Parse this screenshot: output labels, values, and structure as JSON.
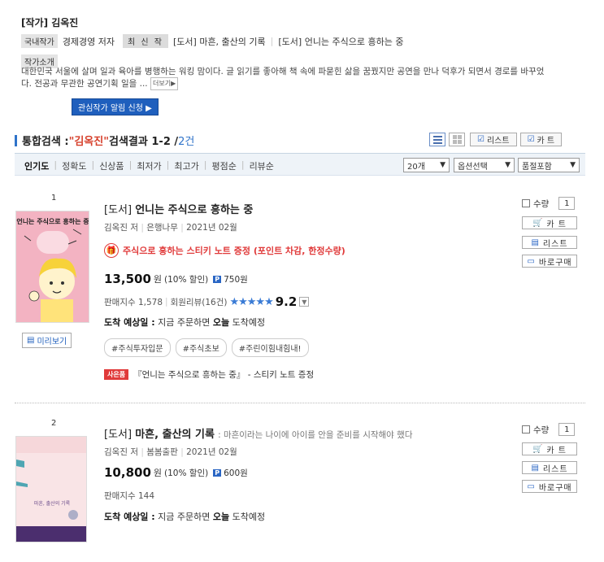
{
  "author": {
    "title": "[작가] 김옥진",
    "nationality_tag": "국내작가",
    "field": "경제경영 저자",
    "latest_tag": "최 신 작",
    "latest_books": [
      "[도서] 마흔, 출산의 기록",
      "[도서] 언니는 주식으로 흥하는 중"
    ],
    "intro_label": "작가소개",
    "intro_text": "대한민국 서울에 살며 일과 육아를 병행하는 워킹 맘이다. 글 읽기를 좋아해 책 속에 파묻힌 삶을 꿈꿨지만 공연을 만나 덕후가 되면서 경로를 바꾸었다. 전공과 무관한 공연기획 일을 ...",
    "more_label": "더보기",
    "follow_button": "관심작가 알림 신청 ▶"
  },
  "results": {
    "heading_prefix": "통합검색 : ",
    "keyword": "\"김옥진\"",
    "heading_suffix": " 검색결과 1-2 / ",
    "total": "2건",
    "list_button": "리스트",
    "cart_button": "카 트"
  },
  "sort": {
    "options": [
      "인기도",
      "정확도",
      "신상품",
      "최저가",
      "최고가",
      "평점순",
      "리뷰순"
    ],
    "per_page": "20개",
    "option_select": "옵션선택",
    "stock_select": "품절포함"
  },
  "items": [
    {
      "rank": "1",
      "category": "[도서]",
      "title": "언니는 주식으로 흥하는 중",
      "subtitle": "",
      "author": "김옥진 저",
      "publisher": "은행나무",
      "date": "2021년 02월",
      "event_icon": "gift-icon",
      "event_text": "주식으로 흥하는 스티키 노트 증정 (포인트 차감, 한정수량)",
      "price": "13,500",
      "won": "원",
      "discount": "(10% 할인)",
      "points": "750원",
      "sales": "판매지수 1,578",
      "reviews": "회원리뷰(16건)",
      "stars": "★★★★★",
      "score": "9.2",
      "arrival_label": "도착 예상일 :",
      "arrival_pre": "지금 주문하면",
      "arrival_day": "오늘",
      "arrival_post": "도착예정",
      "hashtags": [
        "#주식투자입문",
        "#주식초보",
        "#주린이힘내힘내!"
      ],
      "gift_badge": "사은품",
      "gift_text": "『언니는 주식으로 흥하는 중』 - 스티키 노트 증정",
      "preview": "미리보기",
      "cover_text": "언니는 주식으로 흥하는 중",
      "cover_color": "#f4b6c4"
    },
    {
      "rank": "2",
      "category": "[도서]",
      "title": "마흔, 출산의 기록",
      "subtitle": ": 마흔이라는 나이에 아이를 안을 준비를 시작해야 했다",
      "author": "김옥진 저",
      "publisher": "봄봄출판",
      "date": "2021년 02월",
      "price": "10,800",
      "won": "원",
      "discount": "(10% 할인)",
      "points": "600원",
      "sales": "판매지수 144",
      "arrival_label": "도착 예상일 :",
      "arrival_pre": "지금 주문하면",
      "arrival_day": "오늘",
      "arrival_post": "도착예정",
      "cover_text": "마흔, 출산의 기록",
      "cover_color": "#f6d5d8"
    }
  ],
  "side": {
    "qty_label": "수량",
    "qty_value": "1",
    "cart": "카 트",
    "list": "리스트",
    "buy": "바로구매"
  }
}
